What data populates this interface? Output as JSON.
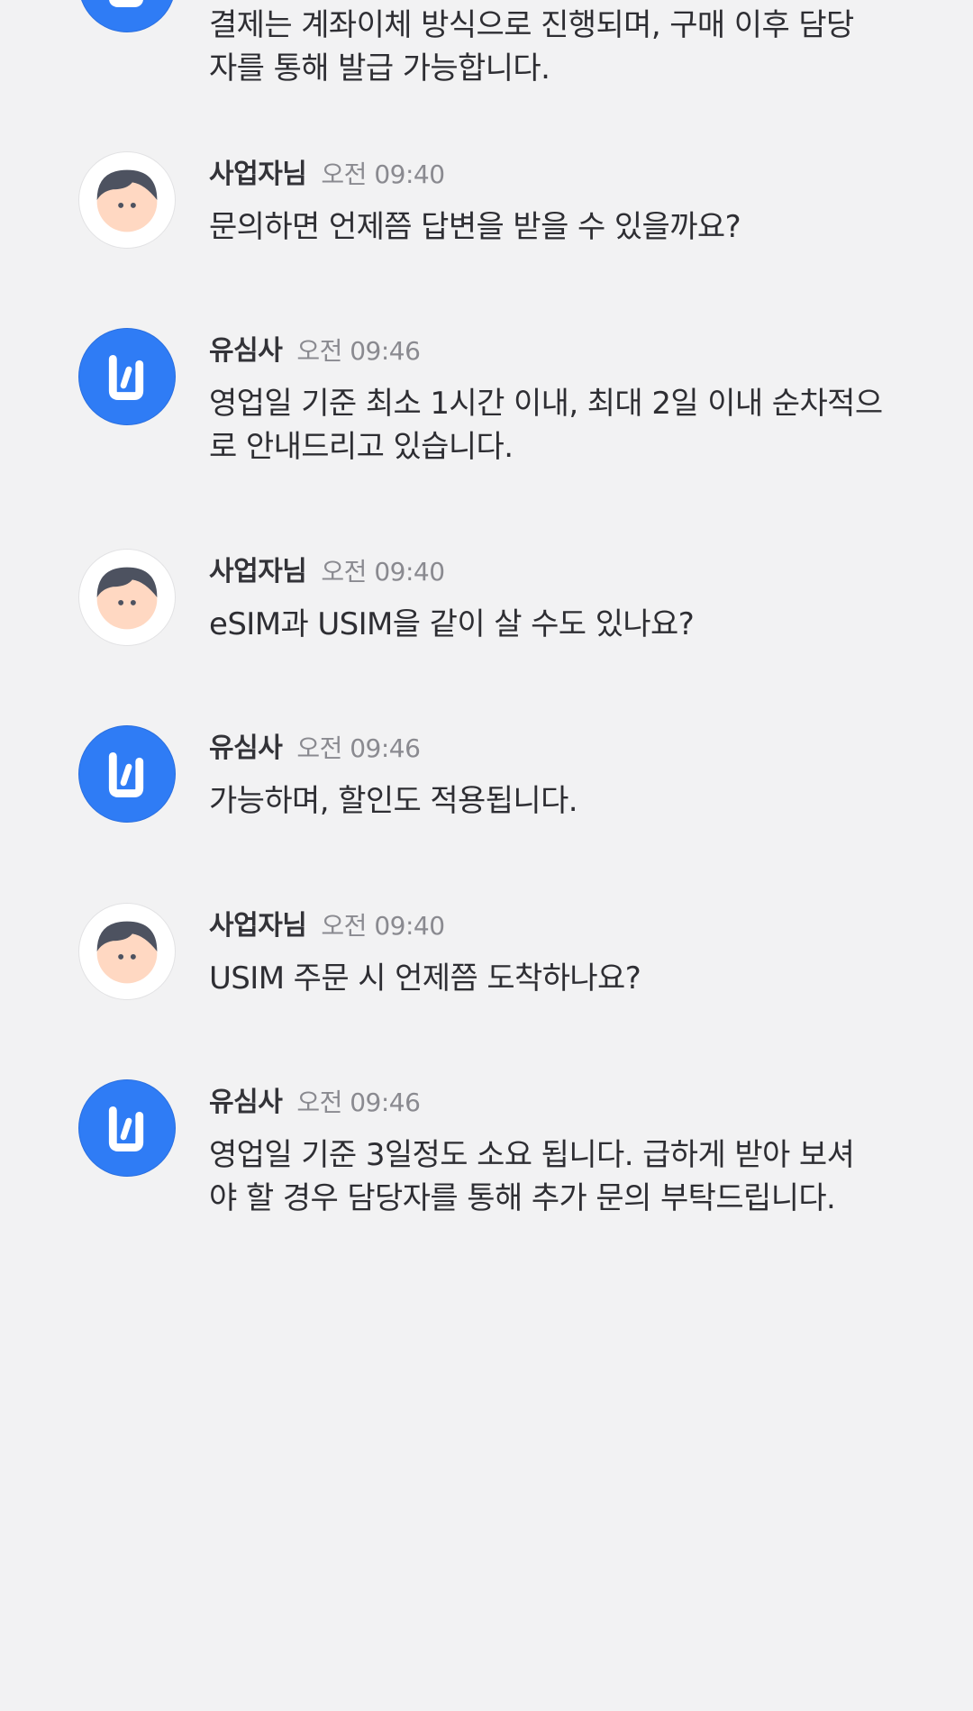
{
  "messages": [
    {
      "sender": "brand",
      "name": "",
      "time": "",
      "lines": [
        "결제는 계좌이체 방식으로 진행되며, 구매 이후 담당",
        "자를 통해 발급 가능합니다."
      ]
    },
    {
      "sender": "user",
      "name": "사업자님",
      "time": "오전 09:40",
      "lines": [
        "문의하면 언제쯤 답변을 받을 수 있을까요?"
      ]
    },
    {
      "sender": "brand",
      "name": "유심사",
      "time": "오전 09:46",
      "lines": [
        "영업일 기준 최소 1시간 이내, 최대 2일 이내 순차적으",
        "로 안내드리고 있습니다."
      ]
    },
    {
      "sender": "user",
      "name": "사업자님",
      "time": "오전 09:40",
      "lines": [
        "eSIM과 USIM을 같이 살 수도 있나요?"
      ]
    },
    {
      "sender": "brand",
      "name": "유심사",
      "time": "오전 09:46",
      "lines": [
        "가능하며, 할인도 적용됩니다."
      ]
    },
    {
      "sender": "user",
      "name": "사업자님",
      "time": "오전 09:40",
      "lines": [
        "USIM 주문 시 언제쯤 도착하나요?"
      ]
    },
    {
      "sender": "brand",
      "name": "유심사",
      "time": "오전 09:46",
      "lines": [
        "영업일 기준 3일정도 소요 됩니다. 급하게 받아 보셔",
        "야 할 경우 담당자를 통해 추가 문의 부탁드립니다."
      ]
    }
  ],
  "icons": {
    "user_avatar": "user-face-icon",
    "brand_avatar": "usimsa-logo-icon"
  },
  "colors": {
    "background": "#f2f2f3",
    "brand_blue": "#2f7cf5",
    "time_gray": "#8a8a90"
  }
}
